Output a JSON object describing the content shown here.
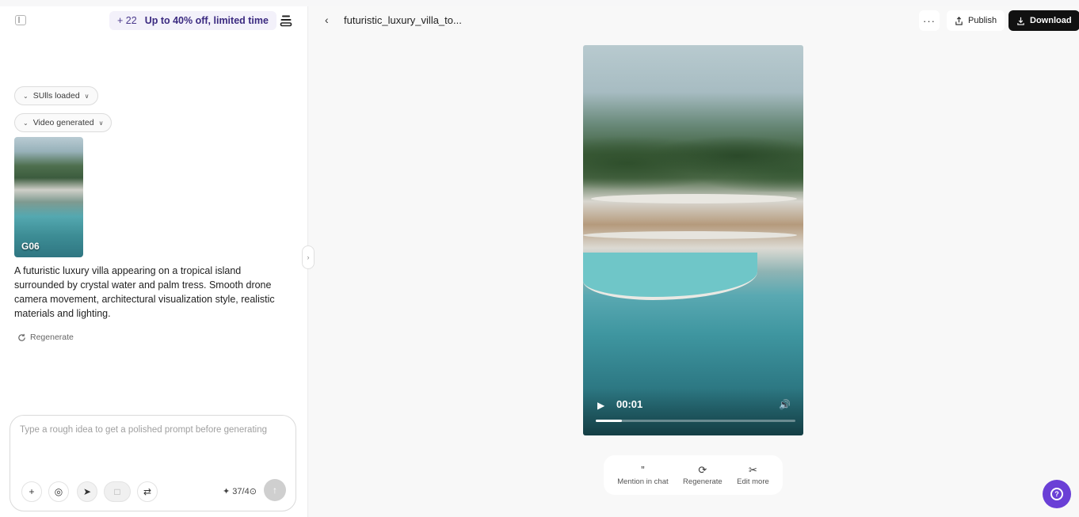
{
  "promo": {
    "credits": "+ 22",
    "offer": "Up to 40% off, limited time"
  },
  "chips": {
    "skills": "SUlls loaded",
    "video": "Video generated"
  },
  "thumbnail": {
    "caption": "G06"
  },
  "prompt_text": "A futuristic luxury villa appearing on a tropical island surrounded by crystal water and palm tress. Smooth drone camera movement, architectural visualization style, realistic materials and lighting.",
  "regenerate_link": "Regenerate",
  "composer": {
    "placeholder": "Type a rough idea to get a polished prompt before generating",
    "counter": "37/4⊙",
    "counter_prefix": "✦"
  },
  "header": {
    "file_name": "futuristic_luxury_villa_to...",
    "more": "···",
    "publish": "Publish",
    "download": "Download"
  },
  "video": {
    "time": "00:01",
    "progress": 0.13
  },
  "actions": {
    "mention": "Mention in chat",
    "regenerate": "Regenerate",
    "edit_more": "Edit more"
  },
  "icons": {
    "sidebar": "sidebar-toggle-icon",
    "stack": "layers-icon",
    "help": "help-icon"
  },
  "colors": {
    "accent": "#6a3fd6",
    "download_bg": "#111111",
    "promo_text": "#3b2a80"
  }
}
